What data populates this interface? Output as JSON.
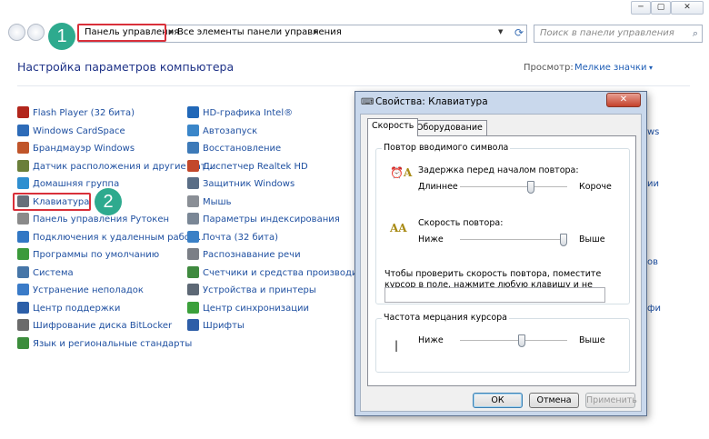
{
  "window": {
    "controls": [
      "─",
      "▢",
      "✕"
    ]
  },
  "address_bar": {
    "crumbs": [
      "Панель управления",
      "Все элементы панели управления"
    ],
    "search_placeholder": "Поиск в панели управления"
  },
  "header": {
    "title": "Настройка параметров компьютера",
    "view_label": "Просмотр:",
    "view_value": "Мелкие значки"
  },
  "badges": [
    "1",
    "2"
  ],
  "items_col1": [
    {
      "label": "Flash Player (32 бита)",
      "icon": "flash-icon",
      "color": "#b2261c"
    },
    {
      "label": "Windows CardSpace",
      "icon": "cardspace-icon",
      "color": "#2d6bb8"
    },
    {
      "label": "Брандмауэр Windows",
      "icon": "firewall-icon",
      "color": "#c0552a"
    },
    {
      "label": "Датчик расположения и другие дат...",
      "icon": "sensor-icon",
      "color": "#6a7f3a"
    },
    {
      "label": "Домашняя группа",
      "icon": "homegroup-icon",
      "color": "#2f8fd0"
    },
    {
      "label": "Клавиатура",
      "icon": "keyboard-icon",
      "color": "#666f7a"
    },
    {
      "label": "Панель управления Рутокен",
      "icon": "rutoken-icon",
      "color": "#8a8a8a"
    },
    {
      "label": "Подключения к удаленным рабоч...",
      "icon": "remote-desktop-icon",
      "color": "#3277c4"
    },
    {
      "label": "Программы по умолчанию",
      "icon": "default-programs-icon",
      "color": "#3b9a3b"
    },
    {
      "label": "Система",
      "icon": "system-icon",
      "color": "#4676a8"
    },
    {
      "label": "Устранение неполадок",
      "icon": "troubleshoot-icon",
      "color": "#3a7bc8"
    },
    {
      "label": "Центр поддержки",
      "icon": "action-center-icon",
      "color": "#2c5fa8"
    },
    {
      "label": "Шифрование диска BitLocker",
      "icon": "bitlocker-icon",
      "color": "#6b6b6b"
    },
    {
      "label": "Язык и региональные стандарты",
      "icon": "region-icon",
      "color": "#3c8d3c"
    }
  ],
  "items_col2": [
    {
      "label": "HD-графика Intel®",
      "icon": "intel-graphics-icon",
      "color": "#2168b8"
    },
    {
      "label": "Автозапуск",
      "icon": "autoplay-icon",
      "color": "#3a86c9"
    },
    {
      "label": "Восстановление",
      "icon": "recovery-icon",
      "color": "#3d7ab8"
    },
    {
      "label": "Диспетчер Realtek HD",
      "icon": "realtek-icon",
      "color": "#c2482b"
    },
    {
      "label": "Защитник Windows",
      "icon": "defender-icon",
      "color": "#5a6e86"
    },
    {
      "label": "Мышь",
      "icon": "mouse-icon",
      "color": "#8a8f96"
    },
    {
      "label": "Параметры индексирования",
      "icon": "indexing-icon",
      "color": "#7a8796"
    },
    {
      "label": "Почта (32 бита)",
      "icon": "mail-icon",
      "color": "#3a80c6"
    },
    {
      "label": "Распознавание речи",
      "icon": "speech-icon",
      "color": "#7b7f86"
    },
    {
      "label": "Счетчики и средства производител...",
      "icon": "performance-icon",
      "color": "#3f8a3f"
    },
    {
      "label": "Устройства и принтеры",
      "icon": "printer-icon",
      "color": "#5d6875"
    },
    {
      "label": "Центр синхронизации",
      "icon": "sync-icon",
      "color": "#3ba03b"
    },
    {
      "label": "Шрифты",
      "icon": "fonts-icon",
      "color": "#2e5ea8"
    }
  ],
  "col3_fragments": [
    "ws",
    "ии",
    "ов",
    "фи"
  ],
  "dialog": {
    "title": "Свойства: Клавиатура",
    "close": "✕",
    "tabs": [
      "Скорость",
      "Оборудование"
    ],
    "repeat_group": "Повтор вводимого символа",
    "delay_label": "Задержка перед началом повтора:",
    "delay_min": "Длиннее",
    "delay_max": "Короче",
    "rate_label": "Скорость повтора:",
    "rate_min": "Ниже",
    "rate_max": "Выше",
    "test_hint": "Чтобы проверить скорость повтора, поместите курсор в поле, нажмите любую клавишу и не отпускайте ее:",
    "blink_group": "Частота мерцания курсора",
    "blink_min": "Ниже",
    "blink_max": "Выше",
    "ok": "ОК",
    "cancel": "Отмена",
    "apply": "Применить",
    "delay_value": 0.67,
    "rate_value": 1.0,
    "blink_value": 0.58
  }
}
